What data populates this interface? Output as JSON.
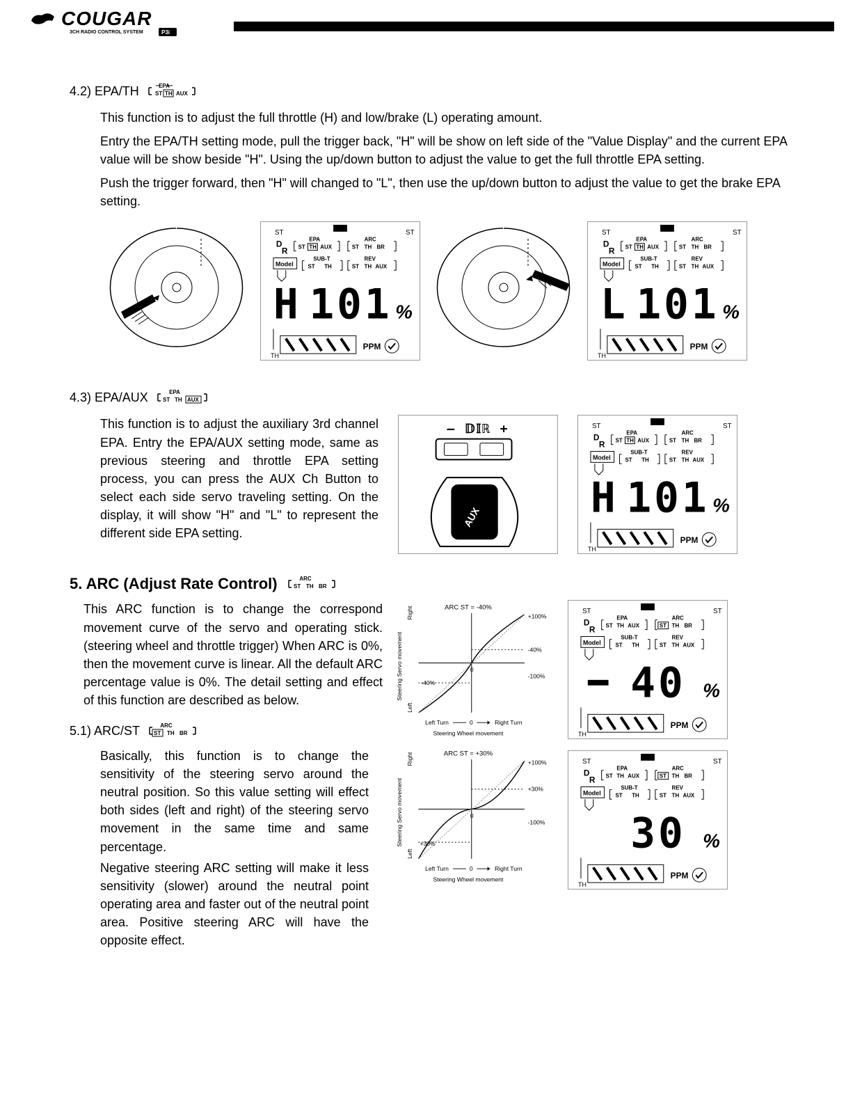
{
  "logo": {
    "brand": "COUGAR",
    "tagline": "3CH RADIO CONTROL SYSTEM",
    "badge": "P3i"
  },
  "s42": {
    "label": "4.2)  EPA/TH",
    "p1": "This function is to adjust the full throttle (H) and low/brake (L) operating amount.",
    "p2": "Entry the EPA/TH setting mode, pull the trigger back, \"H\" will be show on left side of the \"Value Display\" and the current EPA value will be show beside \"H\". Using the up/down button to adjust the value to get the full throttle EPA setting.",
    "p3": "Push the trigger forward, then \"H\" will changed to \"L\", then use the up/down button to adjust the value to get the brake EPA setting."
  },
  "bracket_labels": {
    "epa": "EPA",
    "arc": "ARC",
    "subt": "SUB-T",
    "rev": "REV",
    "st": "ST",
    "th": "TH",
    "aux": "AUX",
    "br": "BR",
    "dr": "D",
    "r": "R",
    "model": "Model",
    "ppm": "PPM"
  },
  "lcd": {
    "h_value": "H 101 %",
    "l_value": "L 101 %",
    "neg40": "- 40 %",
    "pos30": "30 %"
  },
  "s43": {
    "label": "4.3) EPA/AUX",
    "p1": "This function is to adjust the auxiliary 3rd channel EPA. Entry the EPA/AUX setting mode, same as previous steering and throttle EPA setting process, you can press the AUX Ch Button to select each side servo traveling setting. On the display, it will show \"H\" and \"L\" to represent the different side EPA setting."
  },
  "dir_label": "DIR",
  "aux_label": "AUX",
  "s5": {
    "heading": "5. ARC (Adjust Rate Control)",
    "p1": "This ARC function is to change the correspond movement curve of the servo and operating stick. (steering wheel and throttle trigger) When ARC is 0%, then the movement curve is linear. All the default ARC percentage value is 0%. The detail setting and effect of this function are described as below."
  },
  "s51": {
    "label": "5.1) ARC/ST",
    "p1": "Basically, this function is to change the sensitivity of the steering servo around the neutral position. So this value setting will effect both sides (left and right) of the steering servo movement in the same time and same percentage.",
    "p2": "Negative steering ARC setting will make it less sensitivity (slower) around the neutral point operating area and faster out of the neutral point area. Positive steering ARC will have the opposite effect."
  },
  "graph1": {
    "title": "ARC ST = -40%",
    "yaxis": "Steering Servo movement",
    "left": "Left",
    "right": "Right",
    "lturn": "Left Turn",
    "rturn": "Right Turn",
    "caption": "Steering Wheel movement",
    "p100": "+100%",
    "n40a": "-40%",
    "n40b": "-40%",
    "n100": "-100%",
    "zero": "0"
  },
  "graph2": {
    "title": "ARC ST = +30%",
    "yaxis": "Steering Servo movement",
    "left": "Left",
    "right": "Right",
    "lturn": "Left Turn",
    "rturn": "Right Turn",
    "caption": "Steering Wheel movement",
    "p100": "+100%",
    "p30a": "+30%",
    "p30b": "+30%",
    "n100": "-100%",
    "zero": "0"
  }
}
